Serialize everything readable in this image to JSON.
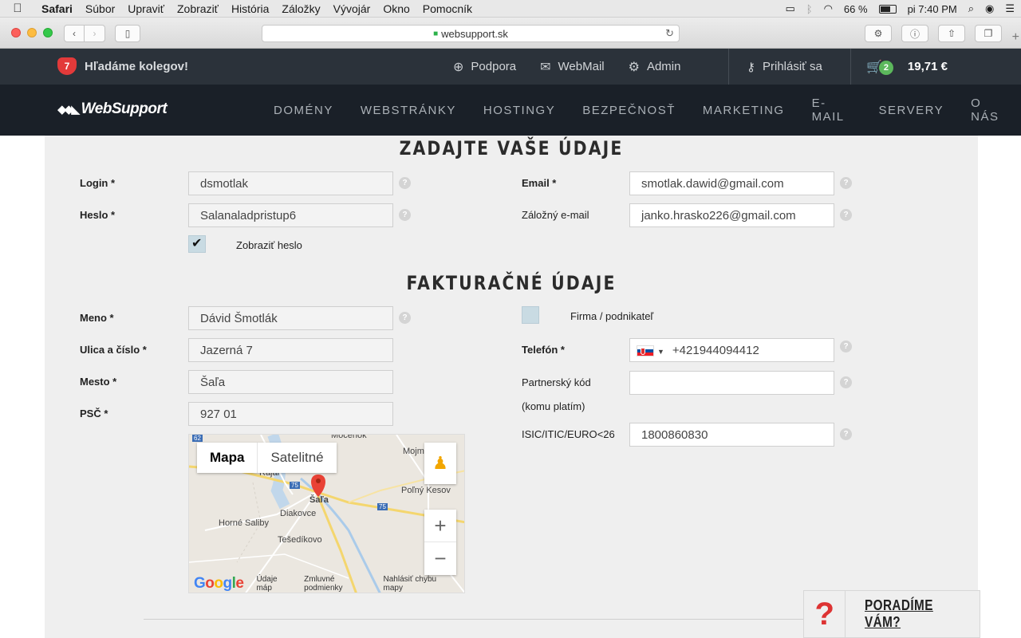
{
  "menubar": {
    "apple": "",
    "app": "Safari",
    "items": [
      "Súbor",
      "Upraviť",
      "Zobraziť",
      "História",
      "Záložky",
      "Vývojár",
      "Okno",
      "Pomocník"
    ],
    "battery": "66 %",
    "clock": "pi 7:40 PM"
  },
  "browser": {
    "url": "websupport.sk"
  },
  "topbar": {
    "badge": "7",
    "hiring": "Hľadáme kolegov!",
    "links": [
      "Podpora",
      "WebMail",
      "Admin"
    ],
    "login": "Prihlásiť sa",
    "cart_count": "2",
    "cart_price": "19,71 €"
  },
  "nav": {
    "logo": "WebSupport",
    "items": [
      "DOMÉNY",
      "WEBSTRÁNKY",
      "HOSTINGY",
      "BEZPEČNOSŤ",
      "MARKETING",
      "E-MAIL",
      "SERVERY",
      "O NÁS"
    ]
  },
  "account": {
    "heading": "ZADAJTE VAŠE ÚDAJE",
    "login_label": "Login *",
    "login_value": "dsmotlak",
    "password_label": "Heslo *",
    "password_value": "Salanaladpristup6",
    "show_password": "Zobraziť heslo",
    "email_label": "Email *",
    "email_value": "smotlak.dawid@gmail.com",
    "backup_email_label": "Záložný e-mail",
    "backup_email_value": "janko.hrasko226@gmail.com"
  },
  "billing": {
    "heading": "FAKTURAČNÉ ÚDAJE",
    "name_label": "Meno *",
    "name_value": "Dávid Šmotlák",
    "street_label": "Ulica a číslo *",
    "street_value": "Jazerná 7",
    "city_label": "Mesto *",
    "city_value": "Šaľa",
    "zip_label": "PSČ *",
    "zip_value": "927 01",
    "company_label": "Firma / podnikateľ",
    "phone_label": "Telefón *",
    "phone_value": "+421944094412",
    "partner_label_1": "Partnerský kód",
    "partner_label_2": "(komu platím)",
    "partner_value": "",
    "isic_label": "ISIC/ITIC/EURO<26",
    "isic_value": "1800860830"
  },
  "map": {
    "tab_map": "Mapa",
    "tab_satellite": "Satelitné",
    "zoom_in": "+",
    "zoom_out": "−",
    "google": "Google",
    "footer_links": [
      "Údaje máp",
      "Zmluvné podmienky",
      "Nahlásiť chybu mapy"
    ],
    "places": [
      "Močenok",
      "Mojm",
      "Poľný Kesov",
      "Šaľa",
      "Diakovce",
      "Horné Saliby",
      "Tešedíkovo",
      "Rajar",
      "62",
      "75",
      "75"
    ]
  },
  "help": {
    "icon": "?",
    "advise": "PORADÍME VÁM?"
  }
}
